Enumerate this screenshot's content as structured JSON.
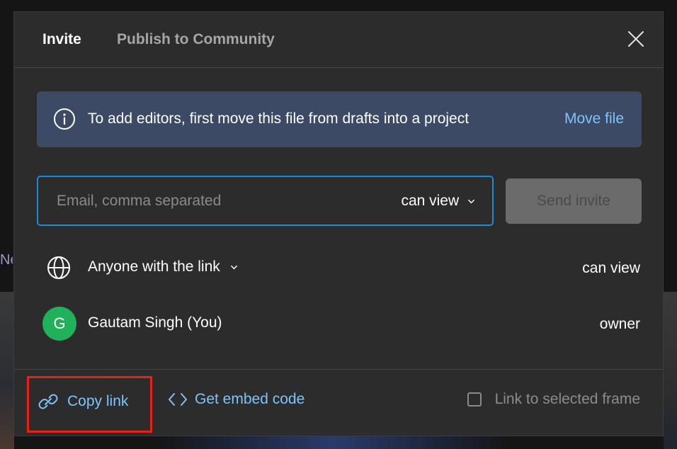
{
  "background": {
    "partial_text": "Ne"
  },
  "dialog": {
    "tabs": [
      {
        "label": "Invite",
        "active": true
      },
      {
        "label": "Publish to Community",
        "active": false
      }
    ],
    "close_icon": "close-icon"
  },
  "banner": {
    "icon": "info-icon",
    "text": "To add editors, first move this file from drafts into a project",
    "action_label": "Move file",
    "background_color": "#3d4a66",
    "action_color": "#7cc4fa"
  },
  "invite": {
    "email_placeholder": "Email, comma separated",
    "email_value": "",
    "permission_label": "can view",
    "send_label": "Send invite",
    "accent_color": "#1b8bd6"
  },
  "access": {
    "link_row": {
      "icon": "globe-icon",
      "label": "Anyone with the link",
      "permission": "can view"
    },
    "user_row": {
      "avatar_initial": "G",
      "avatar_color": "#20b15a",
      "name": "Gautam Singh (You)",
      "role": "owner"
    }
  },
  "footer": {
    "copy_link_label": "Copy link",
    "embed_label": "Get embed code",
    "frame_option_label": "Link to selected frame",
    "frame_option_checked": false,
    "highlight_color": "#e32219"
  }
}
